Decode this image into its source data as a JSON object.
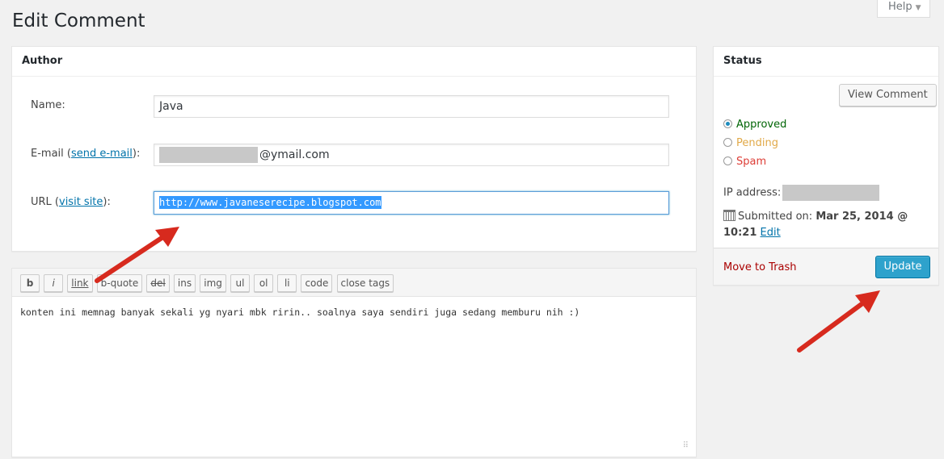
{
  "header": {
    "title": "Edit Comment",
    "help_label": "Help",
    "help_arrow": "▼"
  },
  "author": {
    "heading": "Author",
    "name_label": "Name:",
    "name_value": "Java",
    "email_label": "E-mail (",
    "email_link": "send e-mail",
    "email_suffix": "):",
    "email_value": "@ymail.com",
    "url_label": "URL (",
    "url_link": "visit site",
    "url_suffix": "):",
    "url_value": "http://www.javaneserecipe.blogspot.com"
  },
  "editor": {
    "quicktags": [
      "b",
      "i",
      "link",
      "b-quote",
      "del",
      "ins",
      "img",
      "ul",
      "ol",
      "li",
      "code",
      "close tags"
    ],
    "content": "konten ini memnag banyak sekali yg nyari mbk ririn.. soalnya saya sendiri juga sedang memburu nih :)"
  },
  "status": {
    "heading": "Status",
    "view_comment": "View Comment",
    "options": [
      "Approved",
      "Pending",
      "Spam"
    ],
    "selected": "Approved",
    "ip_label": "IP address:",
    "submitted_label": "Submitted on:",
    "submitted_date": "Mar 25, 2014 @",
    "submitted_time": "10:21",
    "edit_link": "Edit",
    "move_to_trash": "Move to Trash",
    "update": "Update"
  },
  "colors": {
    "primary": "#2ea2cc",
    "link": "#0073aa",
    "approved": "#006505",
    "pending": "#e1a948",
    "spam": "#dd3d36",
    "arrow": "#d72a1e"
  }
}
